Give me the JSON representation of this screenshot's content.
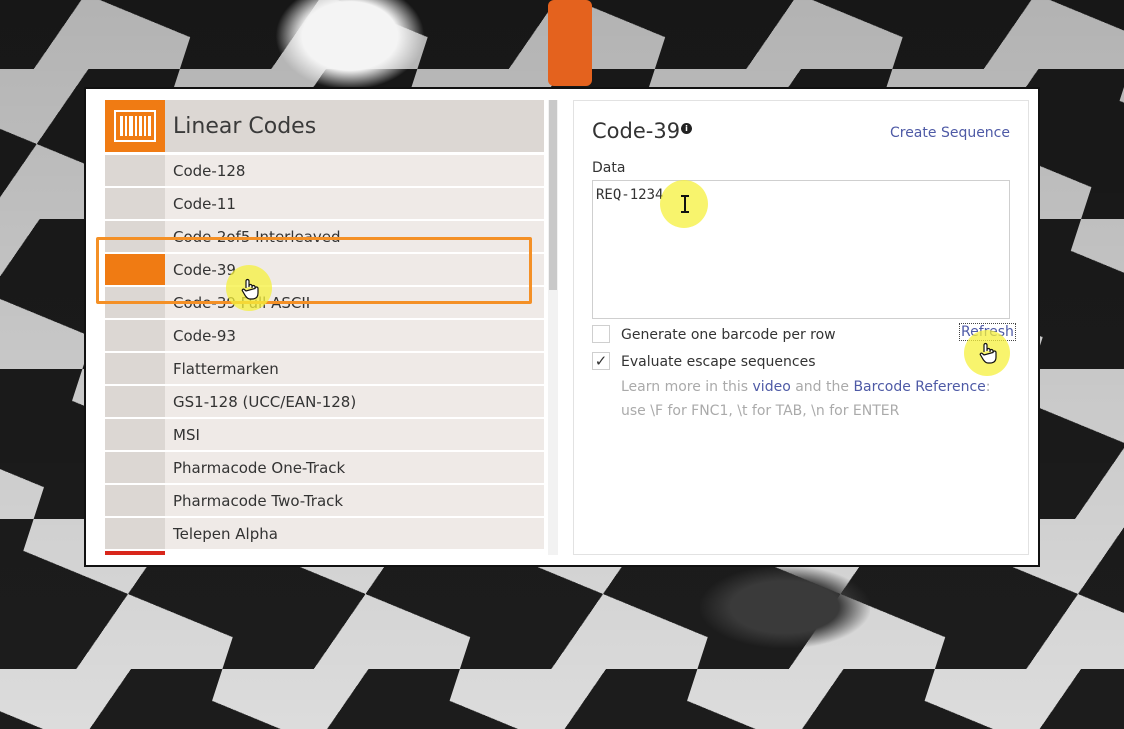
{
  "sidebar": {
    "header_title": "Linear Codes",
    "items": [
      {
        "label": "Code-128",
        "active": false
      },
      {
        "label": "Code-11",
        "active": false
      },
      {
        "label": "Code-2of5 Interleaved",
        "active": false
      },
      {
        "label": "Code-39",
        "active": true
      },
      {
        "label": "Code-39 Full ASCII",
        "active": false
      },
      {
        "label": "Code-93",
        "active": false
      },
      {
        "label": "Flattermarken",
        "active": false
      },
      {
        "label": "GS1-128 (UCC/EAN-128)",
        "active": false
      },
      {
        "label": "MSI",
        "active": false
      },
      {
        "label": "Pharmacode One-Track",
        "active": false
      },
      {
        "label": "Pharmacode Two-Track",
        "active": false
      },
      {
        "label": "Telepen Alpha",
        "active": false
      }
    ]
  },
  "detail": {
    "title": "Code-39",
    "info_icon": "info-icon",
    "create_sequence": "Create Sequence",
    "data_label": "Data",
    "data_value": "REQ-1234",
    "option_one_label": "Generate one barcode per row",
    "option_one_checked": false,
    "option_two_label": "Evaluate escape sequences",
    "option_two_checked": true,
    "check_mark": "✓",
    "refresh": "Refresh",
    "help_prefix": "Learn more in this",
    "help_link_video": "video",
    "help_mid": "and the",
    "help_link_reference": "Barcode Reference",
    "help_suffix": ": use \\F for FNC1, \\t for TAB, \\n for ENTER"
  },
  "colors": {
    "accent": "#f07b13",
    "link": "#4e5aa6",
    "highlight": "#f49026",
    "cursor_glow": "#f6f03c"
  }
}
